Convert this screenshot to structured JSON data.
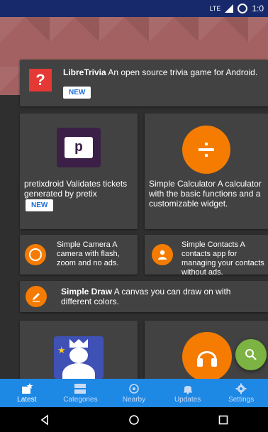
{
  "statusbar": {
    "network": "LTE",
    "time": "1:0"
  },
  "apps": {
    "libretrivia": {
      "name": "LibreTrivia",
      "desc": " An open source trivia game for Android.",
      "badge": "NEW"
    },
    "pretixdroid": {
      "name": "pretixdroid",
      "desc": " Validates tickets generated by pretix",
      "badge": "NEW"
    },
    "calculator": {
      "name": "Simple Calculator",
      "desc": " A calculator with the basic functions and a customizable widget."
    },
    "camera": {
      "name": "Simple Camera",
      "desc": " A camera with flash, zoom and no ads."
    },
    "contacts": {
      "name": "Simple Contacts",
      "desc": " A contacts app for managing your contacts without ads."
    },
    "draw": {
      "name": "Simple Draw",
      "desc": " A canvas you can draw on with different colors."
    }
  },
  "nav": {
    "latest": "Latest",
    "categories": "Categories",
    "nearby": "Nearby",
    "updates": "Updates",
    "settings": "Settings"
  },
  "colors": {
    "accent": "#1e88e5",
    "orange": "#f57c00",
    "fab": "#7cb342",
    "card": "#424242"
  }
}
